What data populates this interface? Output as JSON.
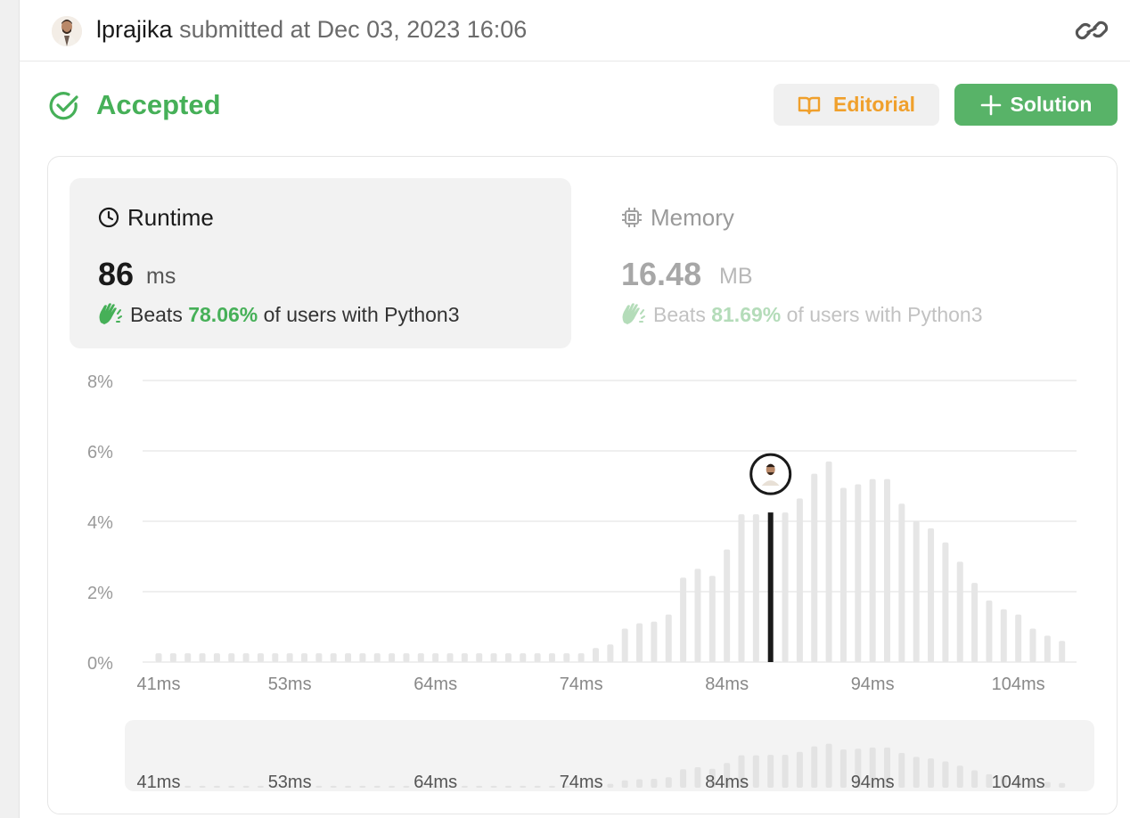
{
  "submission": {
    "username": "lprajika",
    "submitted_text": "submitted at Dec 03, 2023 16:06",
    "status": "Accepted"
  },
  "buttons": {
    "editorial": "Editorial",
    "solution": "Solution"
  },
  "runtime": {
    "title": "Runtime",
    "value": "86",
    "unit": "ms",
    "beats_label": "Beats",
    "beats_pct": "78.06%",
    "beats_suffix": "of users with Python3"
  },
  "memory": {
    "title": "Memory",
    "value": "16.48",
    "unit": "MB",
    "beats_label": "Beats",
    "beats_pct": "81.69%",
    "beats_suffix": "of users with Python3"
  },
  "colors": {
    "accent_green": "#46b058",
    "button_green": "#58b368",
    "editorial_orange": "#f0a02c",
    "bar_gray": "#e6e6e6",
    "selected_bar": "#1a1a1a"
  },
  "chart_data": {
    "type": "bar",
    "title": "",
    "xlabel": "",
    "ylabel": "",
    "ylim": [
      0,
      8
    ],
    "y_ticks": [
      "8%",
      "6%",
      "4%",
      "2%",
      "0%"
    ],
    "x_tick_labels": [
      "41ms",
      "53ms",
      "64ms",
      "74ms",
      "84ms",
      "94ms",
      "104ms"
    ],
    "x_tick_bars": [
      0,
      9,
      19,
      29,
      39,
      49,
      59
    ],
    "selected_bar": 42,
    "selected_label": "86ms",
    "values": [
      0.25,
      0.25,
      0.25,
      0.25,
      0.25,
      0.25,
      0.25,
      0.25,
      0.25,
      0.25,
      0.25,
      0.25,
      0.25,
      0.25,
      0.25,
      0.25,
      0.25,
      0.25,
      0.25,
      0.25,
      0.25,
      0.25,
      0.25,
      0.25,
      0.25,
      0.25,
      0.25,
      0.25,
      0.25,
      0.25,
      0.4,
      0.5,
      0.95,
      1.1,
      1.15,
      1.35,
      2.4,
      2.65,
      2.45,
      3.2,
      4.2,
      4.2,
      4.25,
      4.25,
      4.65,
      5.35,
      5.7,
      4.95,
      5.05,
      5.2,
      5.2,
      4.5,
      4.0,
      3.8,
      3.4,
      2.85,
      2.25,
      1.75,
      1.5,
      1.35,
      0.95,
      0.75,
      0.6
    ]
  }
}
